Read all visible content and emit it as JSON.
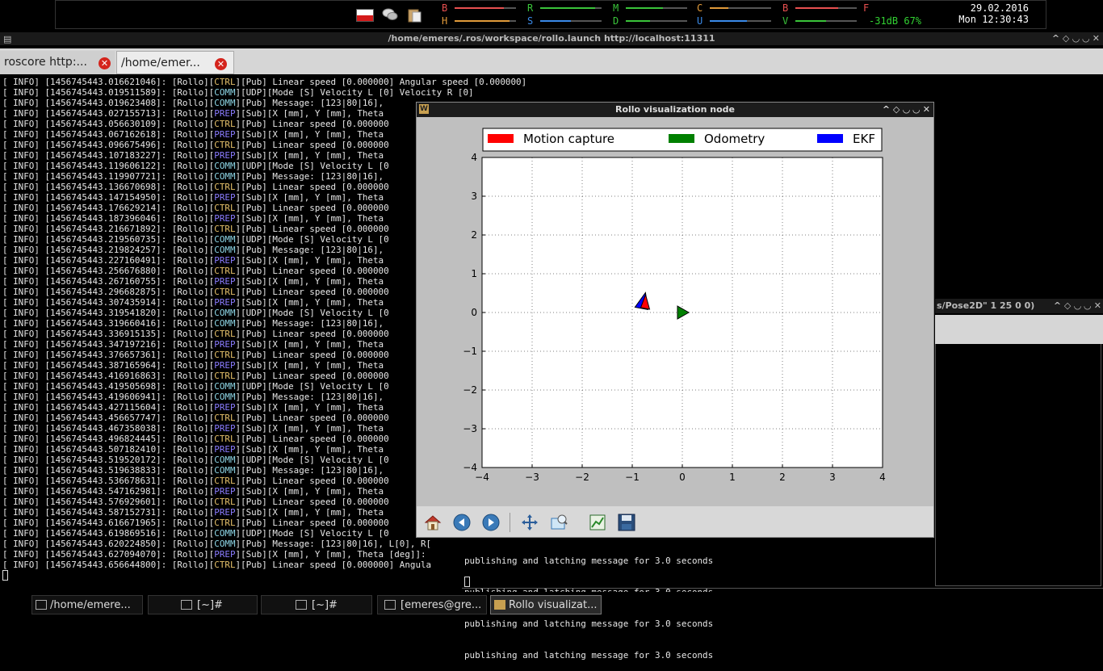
{
  "panel": {
    "meters": [
      {
        "label": "B",
        "color": "#e85050",
        "level": 0.8
      },
      {
        "label": "H",
        "color": "#e09a3a",
        "level": 0.9
      },
      {
        "label": "R",
        "color": "#3ac43a",
        "level": 0.9
      },
      {
        "label": "S",
        "color": "#3a8ae8",
        "level": 0.5
      },
      {
        "label": "M",
        "color": "#3ac43a",
        "level": 0.6
      },
      {
        "label": "D",
        "color": "#3ac43a",
        "level": 0.4
      },
      {
        "label": "C",
        "color": "#e09a3a",
        "level": 0.3
      },
      {
        "label": "U",
        "color": "#3a8ae8",
        "level": 0.6
      },
      {
        "label": "B",
        "color": "#e85050",
        "level": 0.7
      },
      {
        "label": "V",
        "color": "#3ac43a",
        "level": 0.5
      }
    ],
    "meter_f": "F",
    "signal": "-31dB 67%",
    "date": "29.02.2016",
    "time": "Mon 12:30:43"
  },
  "terminal": {
    "title": "/home/emeres/.ros/workspace/rollo.launch http://localhost:11311",
    "tabs": [
      {
        "label": "roscore http:...",
        "active": false
      },
      {
        "label": "/home/emer...",
        "active": true
      }
    ],
    "log": [
      {
        "ts": "1456745443.016621046",
        "tag": "CTRL",
        "msg": "[Pub] Linear speed [0.000000] Angular speed [0.000000]"
      },
      {
        "ts": "1456745443.019511589",
        "tag": "COMM",
        "msg": "[UDP][Mode [S] Velocity L [0] Velocity R [0]"
      },
      {
        "ts": "1456745443.019623408",
        "tag": "COMM",
        "msg": "[Pub] Message: [123|80|16],"
      },
      {
        "ts": "1456745443.027155713",
        "tag": "PREP",
        "msg": "[Sub][X [mm], Y [mm], Theta"
      },
      {
        "ts": "1456745443.056630109",
        "tag": "CTRL",
        "msg": "[Pub] Linear speed [0.000000"
      },
      {
        "ts": "1456745443.067162618",
        "tag": "PREP",
        "msg": "[Sub][X [mm], Y [mm], Theta"
      },
      {
        "ts": "1456745443.096675496",
        "tag": "CTRL",
        "msg": "[Pub] Linear speed [0.000000"
      },
      {
        "ts": "1456745443.107183227",
        "tag": "PREP",
        "msg": "[Sub][X [mm], Y [mm], Theta"
      },
      {
        "ts": "1456745443.119606122",
        "tag": "COMM",
        "msg": "[UDP][Mode [S] Velocity L [0"
      },
      {
        "ts": "1456745443.119907721",
        "tag": "COMM",
        "msg": "[Pub] Message: [123|80|16],"
      },
      {
        "ts": "1456745443.136670698",
        "tag": "CTRL",
        "msg": "[Pub] Linear speed [0.000000"
      },
      {
        "ts": "1456745443.147154950",
        "tag": "PREP",
        "msg": "[Sub][X [mm], Y [mm], Theta"
      },
      {
        "ts": "1456745443.176629214",
        "tag": "CTRL",
        "msg": "[Pub] Linear speed [0.000000"
      },
      {
        "ts": "1456745443.187396046",
        "tag": "PREP",
        "msg": "[Sub][X [mm], Y [mm], Theta"
      },
      {
        "ts": "1456745443.216671892",
        "tag": "CTRL",
        "msg": "[Pub] Linear speed [0.000000"
      },
      {
        "ts": "1456745443.219560735",
        "tag": "COMM",
        "msg": "[UDP][Mode [S] Velocity L [0"
      },
      {
        "ts": "1456745443.219824257",
        "tag": "COMM",
        "msg": "[Pub] Message: [123|80|16],"
      },
      {
        "ts": "1456745443.227160491",
        "tag": "PREP",
        "msg": "[Sub][X [mm], Y [mm], Theta"
      },
      {
        "ts": "1456745443.256676880",
        "tag": "CTRL",
        "msg": "[Pub] Linear speed [0.000000"
      },
      {
        "ts": "1456745443.267160755",
        "tag": "PREP",
        "msg": "[Sub][X [mm], Y [mm], Theta"
      },
      {
        "ts": "1456745443.296682875",
        "tag": "CTRL",
        "msg": "[Pub] Linear speed [0.000000"
      },
      {
        "ts": "1456745443.307435914",
        "tag": "PREP",
        "msg": "[Sub][X [mm], Y [mm], Theta"
      },
      {
        "ts": "1456745443.319541820",
        "tag": "COMM",
        "msg": "[UDP][Mode [S] Velocity L [0"
      },
      {
        "ts": "1456745443.319660416",
        "tag": "COMM",
        "msg": "[Pub] Message: [123|80|16],"
      },
      {
        "ts": "1456745443.336915135",
        "tag": "CTRL",
        "msg": "[Pub] Linear speed [0.000000"
      },
      {
        "ts": "1456745443.347197216",
        "tag": "PREP",
        "msg": "[Sub][X [mm], Y [mm], Theta"
      },
      {
        "ts": "1456745443.376657361",
        "tag": "CTRL",
        "msg": "[Pub] Linear speed [0.000000"
      },
      {
        "ts": "1456745443.387165964",
        "tag": "PREP",
        "msg": "[Sub][X [mm], Y [mm], Theta"
      },
      {
        "ts": "1456745443.416916863",
        "tag": "CTRL",
        "msg": "[Pub] Linear speed [0.000000"
      },
      {
        "ts": "1456745443.419505698",
        "tag": "COMM",
        "msg": "[UDP][Mode [S] Velocity L [0"
      },
      {
        "ts": "1456745443.419606941",
        "tag": "COMM",
        "msg": "[Pub] Message: [123|80|16],"
      },
      {
        "ts": "1456745443.427115604",
        "tag": "PREP",
        "msg": "[Sub][X [mm], Y [mm], Theta"
      },
      {
        "ts": "1456745443.456657747",
        "tag": "CTRL",
        "msg": "[Pub] Linear speed [0.000000"
      },
      {
        "ts": "1456745443.467358038",
        "tag": "PREP",
        "msg": "[Sub][X [mm], Y [mm], Theta"
      },
      {
        "ts": "1456745443.496824445",
        "tag": "CTRL",
        "msg": "[Pub] Linear speed [0.000000"
      },
      {
        "ts": "1456745443.507182410",
        "tag": "PREP",
        "msg": "[Sub][X [mm], Y [mm], Theta"
      },
      {
        "ts": "1456745443.519520172",
        "tag": "COMM",
        "msg": "[UDP][Mode [S] Velocity L [0"
      },
      {
        "ts": "1456745443.519638833",
        "tag": "COMM",
        "msg": "[Pub] Message: [123|80|16],"
      },
      {
        "ts": "1456745443.536678631",
        "tag": "CTRL",
        "msg": "[Pub] Linear speed [0.000000"
      },
      {
        "ts": "1456745443.547162981",
        "tag": "PREP",
        "msg": "[Sub][X [mm], Y [mm], Theta"
      },
      {
        "ts": "1456745443.576929601",
        "tag": "CTRL",
        "msg": "[Pub] Linear speed [0.000000"
      },
      {
        "ts": "1456745443.587152731",
        "tag": "PREP",
        "msg": "[Sub][X [mm], Y [mm], Theta"
      },
      {
        "ts": "1456745443.616671965",
        "tag": "CTRL",
        "msg": "[Pub] Linear speed [0.000000"
      },
      {
        "ts": "1456745443.619869516",
        "tag": "COMM",
        "msg": "[UDP][Mode [S] Velocity L [0"
      },
      {
        "ts": "1456745443.620224850",
        "tag": "COMM",
        "msg": "[Pub] Message: [123|80|16], L[0], R["
      },
      {
        "ts": "1456745443.627094070",
        "tag": "PREP",
        "msg": "[Sub][X [mm], Y [mm], Theta [deg]]:"
      },
      {
        "ts": "1456745443.656644800",
        "tag": "CTRL",
        "msg": "[Pub] Linear speed [0.000000] Angula"
      }
    ]
  },
  "second_terminal": {
    "title": "s/Pose2D\" 1 25 0 0)",
    "lines": [
      "publishing and latching message for 3.0 seconds",
      "publishing and latching message for 3.0 seconds",
      "publishing and latching message for 3.0 seconds",
      "publishing and latching message for 3.0 seconds"
    ]
  },
  "viz": {
    "title": "Rollo visualization node",
    "toolbar": [
      "home-icon",
      "back-icon",
      "forward-icon",
      "pan-icon",
      "zoom-icon",
      "configure-subplots-icon",
      "save-icon"
    ]
  },
  "chart_data": {
    "type": "scatter",
    "xlim": [
      -4,
      4
    ],
    "ylim": [
      -4,
      4
    ],
    "xticks": [
      -4,
      -3,
      -2,
      -1,
      0,
      1,
      2,
      3,
      4
    ],
    "yticks": [
      -4,
      -3,
      -2,
      -1,
      0,
      1,
      2,
      3,
      4
    ],
    "grid": true,
    "legend_position": "top",
    "series": [
      {
        "name": "Motion capture",
        "color": "#ff0000",
        "points": [
          {
            "x": -0.75,
            "y": 0.25
          }
        ]
      },
      {
        "name": "Odometry",
        "color": "#008000",
        "points": [
          {
            "x": 0.0,
            "y": 0.0
          }
        ]
      },
      {
        "name": "EKF",
        "color": "#0000ff",
        "points": [
          {
            "x": -0.8,
            "y": 0.22
          }
        ]
      }
    ]
  },
  "taskbar": {
    "tasks": [
      {
        "label": "/home/emere..."
      },
      {
        "label": "[~]#"
      },
      {
        "label": "[~]#"
      },
      {
        "label": "[emeres@gre..."
      },
      {
        "label": "Rollo visualizat..."
      }
    ]
  },
  "window_buttons": "^ ◇ ◡ ◡ ✕",
  "prompt": "[ INFO] [",
  "node": "[Rollo]"
}
